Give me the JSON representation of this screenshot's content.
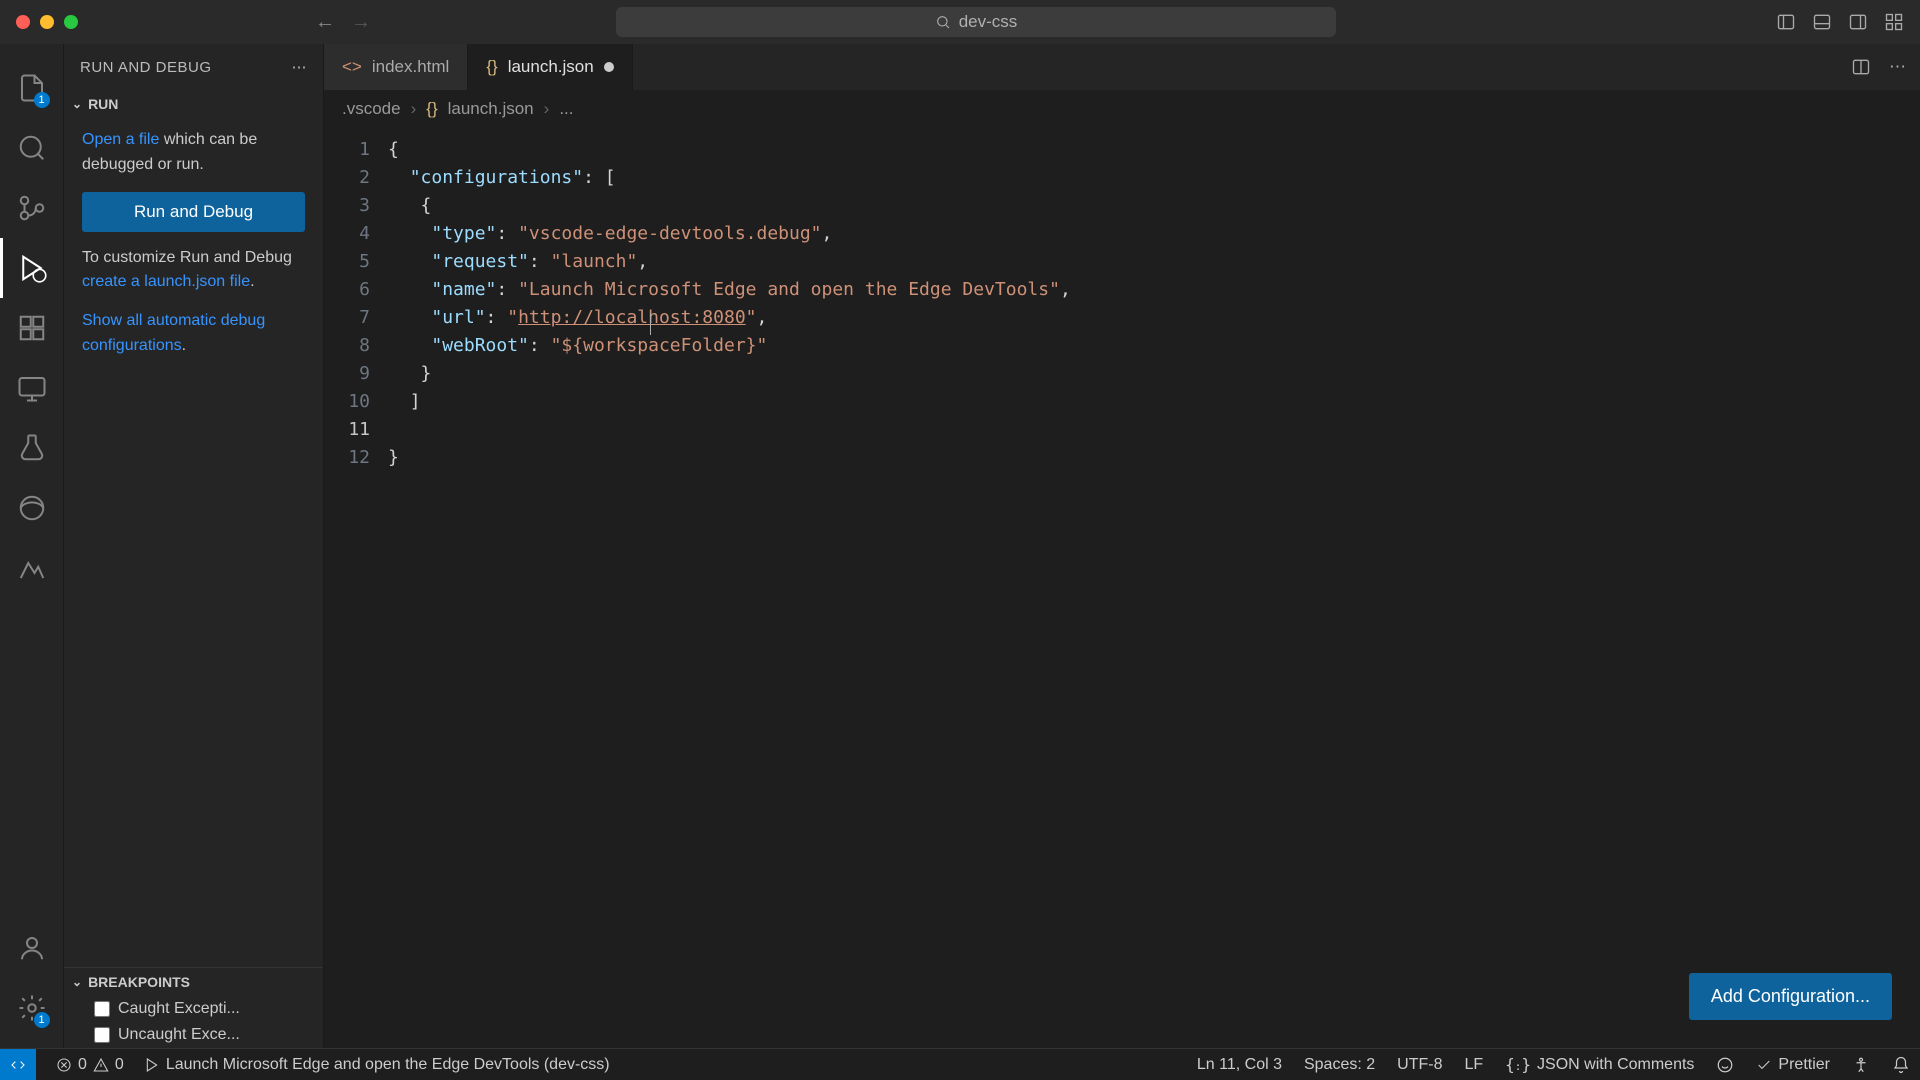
{
  "titlebar": {
    "workspace": "dev-css"
  },
  "activityBar": {
    "explorerBadge": "1",
    "settingsBadge": "1"
  },
  "sidebar": {
    "title": "RUN AND DEBUG",
    "runSection": "RUN",
    "openFileLink": "Open a file",
    "openFileRest": " which can be debugged or run.",
    "runDebugBtn": "Run and Debug",
    "customizePre": "To customize Run and Debug ",
    "createLink": "create a launch.json file",
    "customizePost": ".",
    "showAllLink": "Show all automatic debug configurations",
    "showAllPost": ".",
    "breakpointsTitle": "BREAKPOINTS",
    "bp1": "Caught Excepti...",
    "bp2": "Uncaught Exce..."
  },
  "tabs": {
    "tab1": "index.html",
    "tab2": "launch.json"
  },
  "breadcrumbs": {
    "c1": ".vscode",
    "c2": "launch.json",
    "c3": "..."
  },
  "lineNumbers": [
    "1",
    "2",
    "3",
    "4",
    "5",
    "6",
    "7",
    "8",
    "9",
    "10",
    "11",
    "12"
  ],
  "code": {
    "l1": "{",
    "l2_key": "\"configurations\"",
    "l2_rest": ": [",
    "l3": "{",
    "l4_key": "\"type\"",
    "l4_val": "\"vscode-edge-devtools.debug\"",
    "l5_key": "\"request\"",
    "l5_val": "\"launch\"",
    "l6_key": "\"name\"",
    "l6_val": "\"Launch Microsoft Edge and open the Edge DevTools\"",
    "l7_key": "\"url\"",
    "l7_q1": "\"",
    "l7_url": "http://localhost:8080",
    "l7_q2": "\"",
    "l8_key": "\"webRoot\"",
    "l8_val": "\"${workspaceFolder}\"",
    "l9": "}",
    "l10": "]",
    "l12": "}"
  },
  "addConfigBtn": "Add Configuration...",
  "statusbar": {
    "errors": "0",
    "warnings": "0",
    "launchConfig": "Launch Microsoft Edge and open the Edge DevTools (dev-css)",
    "cursor": "Ln 11, Col 3",
    "spaces": "Spaces: 2",
    "encoding": "UTF-8",
    "eol": "LF",
    "lang": "JSON with Comments",
    "prettier": "Prettier"
  }
}
